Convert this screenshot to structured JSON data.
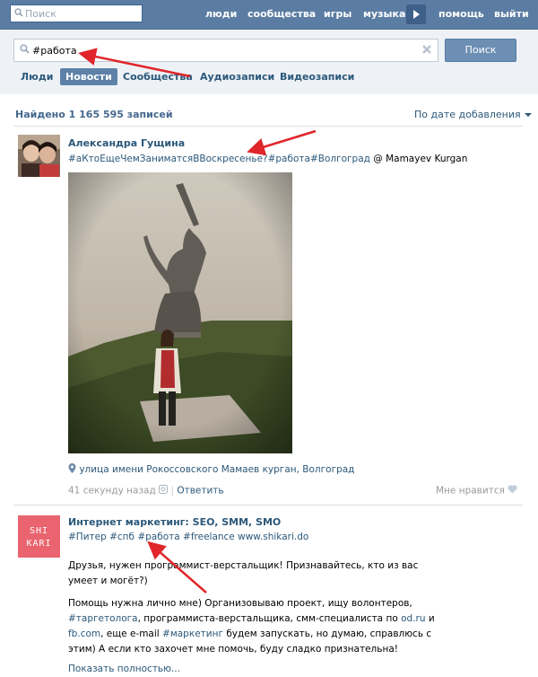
{
  "topbar": {
    "search_placeholder": "Поиск",
    "nav": [
      {
        "label": "люди"
      },
      {
        "label": "сообщества"
      },
      {
        "label": "игры"
      },
      {
        "label": "музыка"
      },
      {
        "label": "помощь"
      },
      {
        "label": "выйти"
      }
    ]
  },
  "search": {
    "query": "#работа",
    "button_label": "Поиск",
    "tabs": [
      {
        "label": "Люди"
      },
      {
        "label": "Новости",
        "active": true
      },
      {
        "label": "Сообщества"
      },
      {
        "label": "Аудиозаписи"
      },
      {
        "label": "Видеозаписи"
      }
    ]
  },
  "results": {
    "summary": "Найдено 1 165 595 записей",
    "sort_label": "По дате добавления"
  },
  "posts": [
    {
      "author": "Александра Гущина",
      "hashtags": "#аКтоЕщеЧемЗаниматсяВВоскресенье?#работа#Волгоград",
      "place": "@ Mamayev Kurgan",
      "location": "улица имени Рокоссовского Мамаев курган, Волгоград",
      "time": "41 секунду назад",
      "reply_label": "Ответить",
      "like_label": "Мне нравится"
    },
    {
      "author": "Интернет маркетинг: SEO, SMM, SMO",
      "avatar_text": "SHIKARI",
      "hashtags": "#Питер #спб #работа #freelance",
      "link": "www.shikari.do",
      "paragraph1": "Друзья, нужен программист-верстальщик! Признавайтесь, кто из вас умеет и могёт?)",
      "p2_a": "Помощь нужна лично мне) Организовываю проект, ищу волонтеров,",
      "p2_tag1": "#таргетолога",
      "p2_b": ", программиста-верстальщика, смм-специалиста по ",
      "p2_link1": "od.ru",
      "p2_c": " и ",
      "p2_link2": "fb.com",
      "p2_d": ", еще e-mail ",
      "p2_tag2": "#маркетинг",
      "p2_e": " будем запускать, но думаю, справлюсь с этим) А если кто захочет мне помочь, буду сладко признательна!",
      "show_more": "Показать полностью..."
    }
  ],
  "colors": {
    "topbar": "#5b7da3",
    "link": "#2b587a",
    "annotation_arrow": "#e0262b"
  }
}
